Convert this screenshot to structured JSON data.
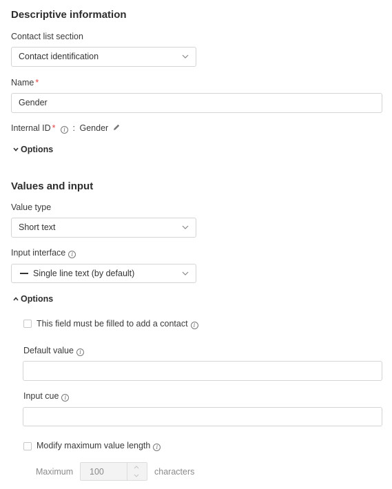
{
  "descriptive": {
    "heading": "Descriptive information",
    "section_label": "Contact list section",
    "section_value": "Contact identification",
    "name_label": "Name",
    "required_mark": "*",
    "name_value": "Gender",
    "internal_id_label": "Internal ID",
    "internal_id_sep": ":",
    "internal_id_value": "Gender",
    "options_label": "Options"
  },
  "values_input": {
    "heading": "Values and input",
    "value_type_label": "Value type",
    "value_type_value": "Short text",
    "input_interface_label": "Input interface",
    "input_interface_value": "Single line text (by default)",
    "options_label": "Options",
    "must_fill_label": "This field must be filled to add a contact",
    "default_value_label": "Default value",
    "default_value": "",
    "input_cue_label": "Input cue",
    "input_cue_value": "",
    "modify_max_label": "Modify maximum value length",
    "maximum_label": "Maximum",
    "maximum_value": "100",
    "characters_label": "characters"
  },
  "icons": {
    "info": "info-icon",
    "chevron": "chevron-down-icon",
    "pencil": "pencil-icon",
    "caret_down": "caret-down-icon",
    "caret_up": "caret-up-icon",
    "dash": "dash-icon"
  }
}
